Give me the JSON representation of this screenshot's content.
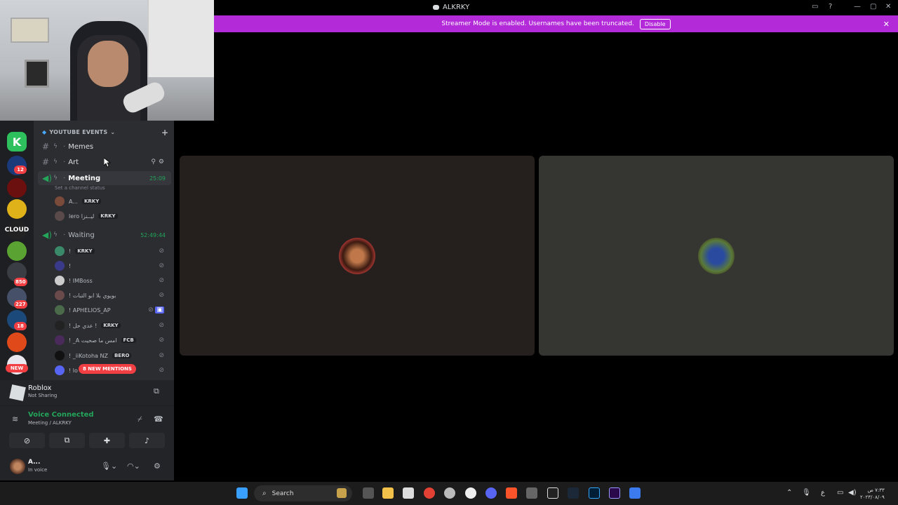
{
  "window": {
    "title": "ALKRKY"
  },
  "banner": {
    "text": "Streamer Mode is enabled. Usernames have been truncated.",
    "disable_label": "Disable",
    "bg_color": "#b32ad8"
  },
  "server_rail": {
    "badges": [
      "12",
      "850",
      "227",
      "18"
    ],
    "new_label": "NEW"
  },
  "sidebar": {
    "category": "YOUTUBE EVENTS",
    "channels": [
      {
        "name": "Memes",
        "type": "text"
      },
      {
        "name": "Art",
        "type": "text"
      },
      {
        "name": "Meeting",
        "type": "voice",
        "timer": "25:09",
        "status": "Set a channel status"
      },
      {
        "name": "Waiting",
        "type": "voice",
        "timer": "52:49:44"
      }
    ],
    "meeting_users": [
      {
        "name": "A...",
        "tag": "KRKY"
      },
      {
        "name": "lero ليــنزا",
        "tag": "KRKY"
      }
    ],
    "waiting_users": [
      {
        "name": "!",
        "tag": "KRKY"
      },
      {
        "name": "!",
        "tag": ""
      },
      {
        "name": "! IMBoss",
        "tag": ""
      },
      {
        "name": "! بويوي بلا ابو التبات",
        "tag": ""
      },
      {
        "name": "! APHELIOS_AP",
        "tag": ""
      },
      {
        "name": "! عدي حل !",
        "tag": "KRKY"
      },
      {
        "name": "! _A امس ما صحيت",
        "tag": "FCB"
      },
      {
        "name": "! _iiKotoha NZ",
        "tag": "BERO"
      },
      {
        "name": "! lo",
        "tag": ""
      }
    ],
    "mentions": "8 NEW MENTIONS"
  },
  "activity": {
    "game": "Roblox",
    "status": "Not Sharing"
  },
  "voice": {
    "status": "Voice Connected",
    "location": "Meeting / ALKRKY"
  },
  "user": {
    "name": "A...",
    "status": "In voice"
  },
  "taskbar": {
    "search_placeholder": "Search",
    "clock_time": "٧:٣٣ ص",
    "clock_date": "٢٠٢٣/٠٨/٠٩",
    "lang": "ع"
  }
}
